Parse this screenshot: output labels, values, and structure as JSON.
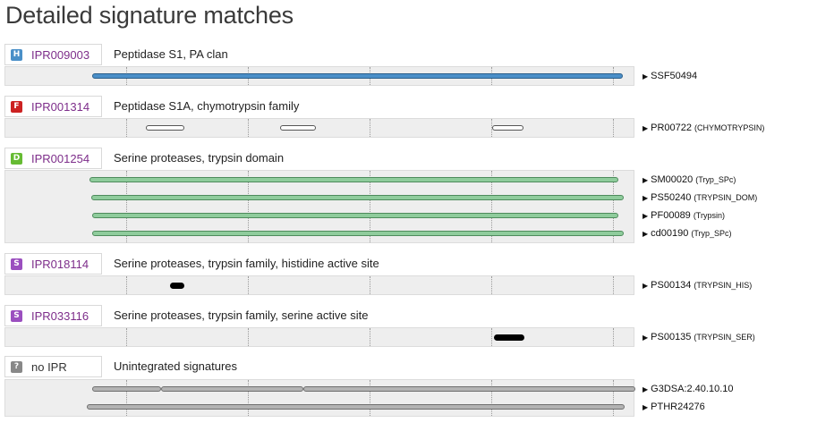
{
  "title": "Detailed signature matches",
  "colors": {
    "homologous_superfamily": "#4a8fc8",
    "family": "#cc2222",
    "domain": "#66bb33",
    "site": "#9b4fbf",
    "unintegrated": "#888888",
    "accession_link": "#7d2d8a"
  },
  "entries": [
    {
      "type_letter": "H",
      "accession": "IPR009003",
      "name": "Peptidase S1, PA clan",
      "signatures": [
        {
          "id": "SSF50494",
          "name": ""
        }
      ]
    },
    {
      "type_letter": "F",
      "accession": "IPR001314",
      "name": "Peptidase S1A, chymotrypsin family",
      "signatures": [
        {
          "id": "PR00722",
          "name": "(CHYMOTRYPSIN)"
        }
      ]
    },
    {
      "type_letter": "D",
      "accession": "IPR001254",
      "name": "Serine proteases, trypsin domain",
      "signatures": [
        {
          "id": "SM00020",
          "name": "(Tryp_SPc)"
        },
        {
          "id": "PS50240",
          "name": "(TRYPSIN_DOM)"
        },
        {
          "id": "PF00089",
          "name": "(Trypsin)"
        },
        {
          "id": "cd00190",
          "name": "(Tryp_SPc)"
        }
      ]
    },
    {
      "type_letter": "S",
      "accession": "IPR018114",
      "name": "Serine proteases, trypsin family, histidine active site",
      "signatures": [
        {
          "id": "PS00134",
          "name": "(TRYPSIN_HIS)"
        }
      ]
    },
    {
      "type_letter": "S",
      "accession": "IPR033116",
      "name": "Serine proteases, trypsin family, serine active site",
      "signatures": [
        {
          "id": "PS00135",
          "name": "(TRYPSIN_SER)"
        }
      ]
    },
    {
      "type_letter": "?",
      "accession": "no IPR",
      "name": "Unintegrated signatures",
      "signatures": [
        {
          "id": "G3DSA:2.40.10.10",
          "name": ""
        },
        {
          "id": "PTHR24276",
          "name": ""
        }
      ]
    }
  ]
}
